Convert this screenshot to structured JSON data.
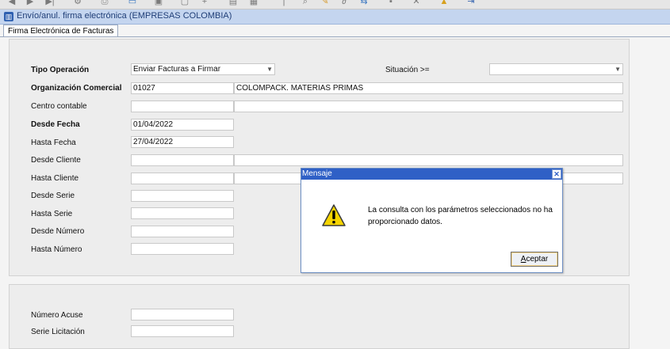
{
  "toolbar": {
    "icons": [
      "prev-icon",
      "next-icon",
      "last-icon",
      "settings-icon",
      "print-icon",
      "monitor-icon",
      "copy-icon",
      "add-icon",
      "paste-icon",
      "search-icon",
      "pencil-icon",
      "attach-icon",
      "export-icon",
      "save-icon",
      "delete-icon",
      "lock-icon",
      "exit-icon"
    ]
  },
  "window": {
    "title": "Envío/anul. firma electrónica (EMPRESAS COLOMBIA)"
  },
  "tabs": [
    {
      "label": "Firma Electrónica de Facturas"
    }
  ],
  "form": {
    "tipo_operacion": {
      "label": "Tipo Operación",
      "value": "Enviar Facturas a Firmar"
    },
    "situacion": {
      "label": "Situación >=",
      "value": ""
    },
    "organizacion_comercial": {
      "label": "Organización Comercial",
      "code": "01027",
      "name": "COLOMPACK. MATERIAS PRIMAS"
    },
    "centro_contable": {
      "label": "Centro contable",
      "code": "",
      "name": ""
    },
    "desde_fecha": {
      "label": "Desde Fecha",
      "value": "01/04/2022"
    },
    "hasta_fecha": {
      "label": "Hasta Fecha",
      "value": "27/04/2022"
    },
    "desde_cliente": {
      "label": "Desde Cliente",
      "code": "",
      "name": ""
    },
    "hasta_cliente": {
      "label": "Hasta Cliente",
      "code": "",
      "name": ""
    },
    "desde_serie": {
      "label": "Desde Serie",
      "value": ""
    },
    "hasta_serie": {
      "label": "Hasta Serie",
      "value": ""
    },
    "desde_numero": {
      "label": "Desde Número",
      "value": ""
    },
    "hasta_numero": {
      "label": "Hasta Número",
      "value": ""
    },
    "numero_acuse": {
      "label": "Número Acuse",
      "value": ""
    },
    "serie_licitacion": {
      "label": "Serie Licitación",
      "value": ""
    }
  },
  "dialog": {
    "title": "Mensaje",
    "close_label": "✕",
    "message": "La consulta con los parámetros seleccionados no ha proporcionado datos.",
    "accept_prefix": "A",
    "accept_rest": "ceptar"
  },
  "colors": {
    "dialog_title": "#2f60c6",
    "window_title": "#c4d5ef",
    "warning_yellow": "#f5d400"
  }
}
